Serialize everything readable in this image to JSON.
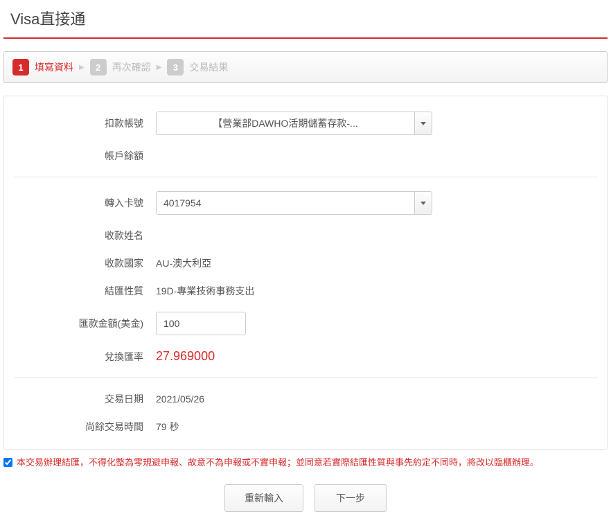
{
  "page_title": "Visa直接通",
  "steps": [
    {
      "num": "1",
      "label": "填寫資料",
      "active": true
    },
    {
      "num": "2",
      "label": "再次確認",
      "active": false
    },
    {
      "num": "3",
      "label": "交易結果",
      "active": false
    }
  ],
  "form": {
    "debit_account": {
      "label": "扣款帳號",
      "value": "【營業部DAWHO活期儲蓄存款-..."
    },
    "balance": {
      "label": "帳戶餘額",
      "value": ""
    },
    "card": {
      "label": "轉入卡號",
      "value": "4017954"
    },
    "payee_name": {
      "label": "收款姓名",
      "value": ""
    },
    "payee_country": {
      "label": "收款國家",
      "value": "AU-澳大利亞"
    },
    "nature": {
      "label": "結匯性質",
      "value": "19D-專業技術事務支出"
    },
    "amount": {
      "label": "匯款金額(美金)",
      "value": "100"
    },
    "rate": {
      "label": "兌換匯率",
      "value": "27.969000"
    },
    "txn_date": {
      "label": "交易日期",
      "value": "2021/05/26"
    },
    "remaining": {
      "label": "尚餘交易時間",
      "value": "79 秒"
    }
  },
  "consent_text": "本交易辦理結匯，不得化整為零規避申報、故意不為申報或不實申報；並同意若實際結匯性質與事先約定不同時，將改以臨櫃辦理。",
  "buttons": {
    "reset": "重新輸入",
    "next": "下一步"
  }
}
